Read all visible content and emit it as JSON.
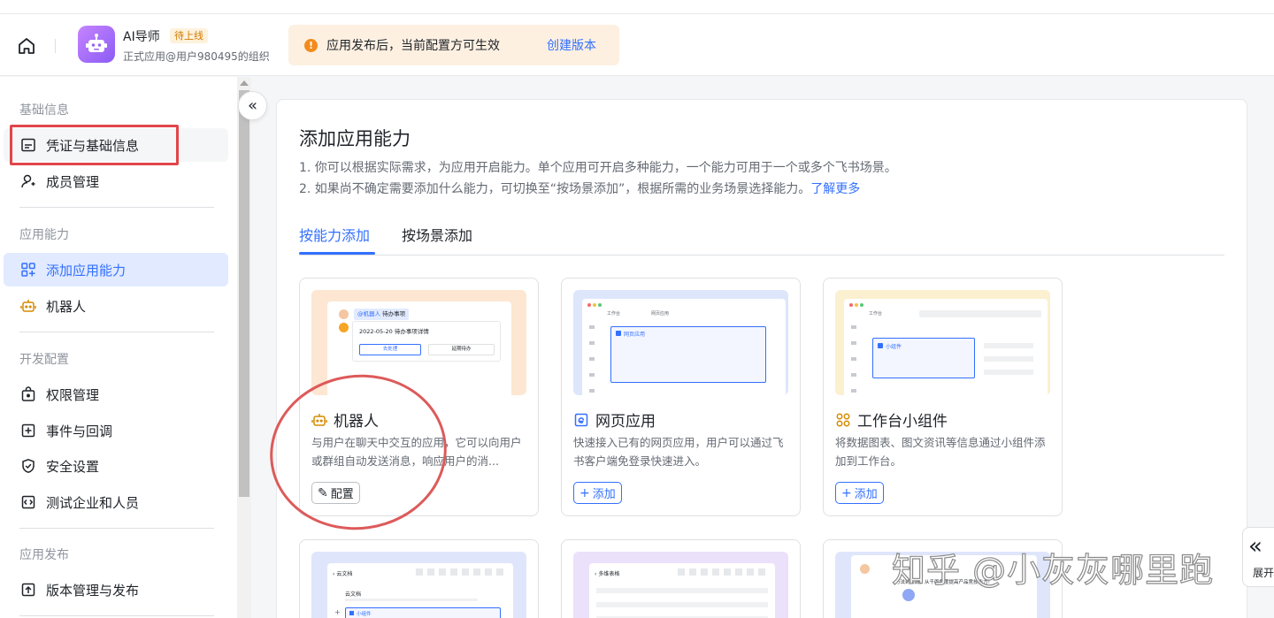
{
  "header": {
    "app_name": "AI导师",
    "app_badge": "待上线",
    "app_org": "正式应用@用户980495的组织",
    "notice_text": "应用发布后，当前配置方可生效",
    "notice_link": "创建版本"
  },
  "sidebar": {
    "sections": [
      "基础信息",
      "应用能力",
      "开发配置",
      "应用发布"
    ],
    "items": [
      {
        "label": "凭证与基础信息",
        "icon": "credential-icon"
      },
      {
        "label": "成员管理",
        "icon": "member-icon"
      },
      {
        "label": "添加应用能力",
        "icon": "add-capability-icon"
      },
      {
        "label": "机器人",
        "icon": "robot-icon"
      },
      {
        "label": "权限管理",
        "icon": "permission-icon"
      },
      {
        "label": "事件与回调",
        "icon": "event-icon"
      },
      {
        "label": "安全设置",
        "icon": "shield-icon"
      },
      {
        "label": "测试企业和人员",
        "icon": "test-icon"
      },
      {
        "label": "版本管理与发布",
        "icon": "version-icon"
      }
    ]
  },
  "main": {
    "title": "添加应用能力",
    "desc_line1": "1. 你可以根据实际需求，为应用开启能力。单个应用可开启多种能力，一个能力可用于一个或多个飞书场景。",
    "desc_line2": "2. 如果尚不确定需要添加什么能力，可切换至“按场景添加”，根据所需的业务场景选择能力。",
    "desc_link": "了解更多",
    "tabs": [
      "按能力添加",
      "按场景添加"
    ],
    "cards": [
      {
        "title": "机器人",
        "desc": "与用户在聊天中交互的应用，它可以向用户或群组自动发送消息，响应用户的消...",
        "button": "配置",
        "mock": {
          "tag1": "@机器人",
          "tag2": "待办事项",
          "line": "2022-05-20 待办事项详情",
          "btn1": "去处理",
          "btn2": "延期待办"
        }
      },
      {
        "title": "网页应用",
        "desc": "快速接入已有的网页应用，用户可以通过飞书客户端免登录快速进入。",
        "button": "添加",
        "mock": {
          "tab1": "工作台",
          "tab2": "网页应用",
          "label": "网页应用"
        }
      },
      {
        "title": "工作台小组件",
        "desc": "将数据图表、图文资讯等信息通过小组件添加到工作台。",
        "button": "添加",
        "mock": {
          "tab1": "工作台",
          "label": "小组件"
        }
      }
    ],
    "bottom_cards": [
      {
        "mock_title": "云文档",
        "mock_sub": "云文档",
        "mock_label": "小组件"
      },
      {
        "mock_title": "多维表格"
      },
      {
        "mock_text": "万法到实践，从千而角度提高产品竞技能力！"
      }
    ]
  },
  "expand_label": "展开",
  "watermark": "知乎 @小灰灰哪里跑",
  "colors": {
    "accent": "#3370ff",
    "annotation": "#e0464b",
    "notice_bg": "#fdf0e1"
  }
}
